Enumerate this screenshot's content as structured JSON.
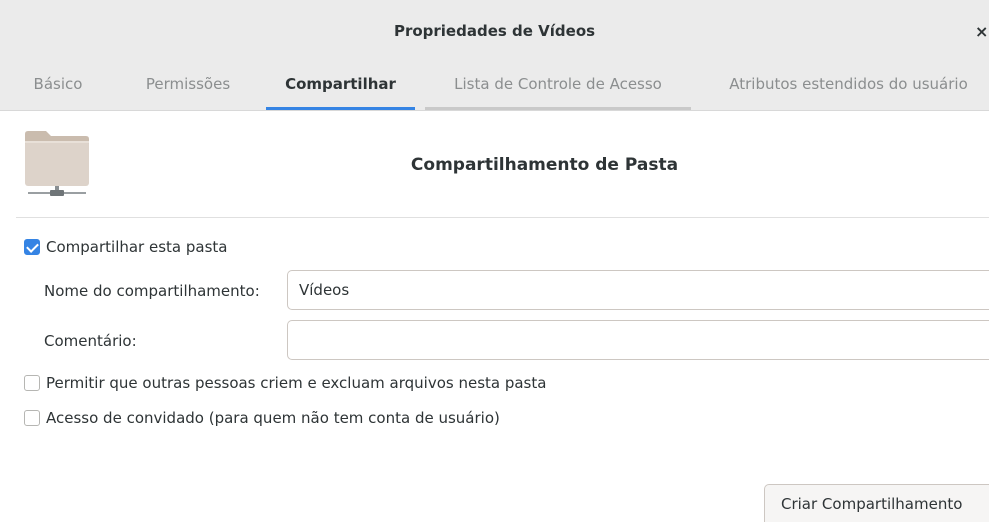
{
  "window": {
    "title": "Propriedades de Vídeos",
    "close_glyph": "×"
  },
  "tabs": [
    {
      "label": "Básico",
      "active": false
    },
    {
      "label": "Permissões",
      "active": false
    },
    {
      "label": "Compartilhar",
      "active": true
    },
    {
      "label": "Lista de Controle de Acesso",
      "active": false
    },
    {
      "label": "Atributos estendidos do usuário",
      "active": false
    }
  ],
  "share": {
    "heading": "Compartilhamento de Pasta",
    "share_folder": {
      "label": "Compartilhar esta pasta",
      "checked": true
    },
    "share_name": {
      "label": "Nome do compartilhamento:",
      "value": "Vídeos"
    },
    "comment": {
      "label": "Comentário:",
      "value": ""
    },
    "allow_write": {
      "label": "Permitir que outras pessoas criem e excluam arquivos nesta pasta",
      "checked": false
    },
    "guest_access": {
      "label": "Acesso de convidado (para quem não tem conta de usuário)",
      "checked": false
    },
    "create_button": "Criar Compartilhamento"
  },
  "icons": {
    "folder": "folder-network-icon",
    "close": "close-icon"
  },
  "colors": {
    "accent": "#3584e4",
    "headerbar": "#ebebeb",
    "folder": "#d9cfc6"
  }
}
